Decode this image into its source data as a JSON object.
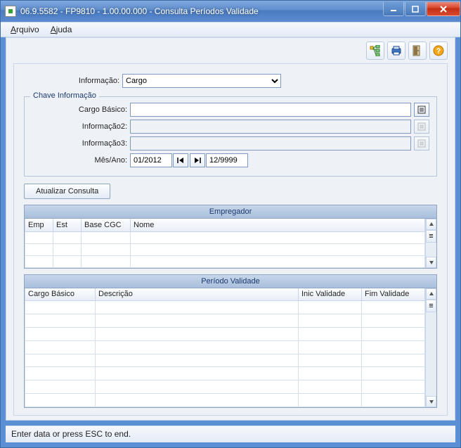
{
  "window": {
    "title": "06.9.5582 - FP9810 - 1.00.00.000 - Consulta Períodos Validade"
  },
  "menu": {
    "arquivo": "Arquivo",
    "ajuda": "Ajuda"
  },
  "form": {
    "informacao_label": "Informação:",
    "informacao_value": "Cargo",
    "fieldset_legend": "Chave Informação",
    "cargo_basico_label": "Cargo Básico:",
    "cargo_basico_value": "",
    "informacao2_label": "Informação2:",
    "informacao2_value": "",
    "informacao3_label": "Informação3:",
    "informacao3_value": "",
    "mes_ano_label": "Mês/Ano:",
    "mes_ano_from": "01/2012",
    "mes_ano_to": "12/9999",
    "atualizar_label": "Atualizar Consulta"
  },
  "grid_empregador": {
    "title": "Empregador",
    "columns": [
      "Emp",
      "Est",
      "Base CGC",
      "Nome"
    ],
    "rows": [
      [
        "",
        "",
        "",
        ""
      ],
      [
        "",
        "",
        "",
        ""
      ],
      [
        "",
        "",
        "",
        ""
      ]
    ]
  },
  "grid_periodo": {
    "title": "Período Validade",
    "columns": [
      "Cargo Básico",
      "Descrição",
      "Inic Validade",
      "Fim Validade"
    ],
    "rows": [
      [
        "",
        "",
        "",
        ""
      ],
      [
        "",
        "",
        "",
        ""
      ],
      [
        "",
        "",
        "",
        ""
      ],
      [
        "",
        "",
        "",
        ""
      ],
      [
        "",
        "",
        "",
        ""
      ],
      [
        "",
        "",
        "",
        ""
      ],
      [
        "",
        "",
        "",
        ""
      ],
      [
        "",
        "",
        "",
        ""
      ]
    ]
  },
  "statusbar": {
    "text": "Enter data or press ESC to end."
  }
}
